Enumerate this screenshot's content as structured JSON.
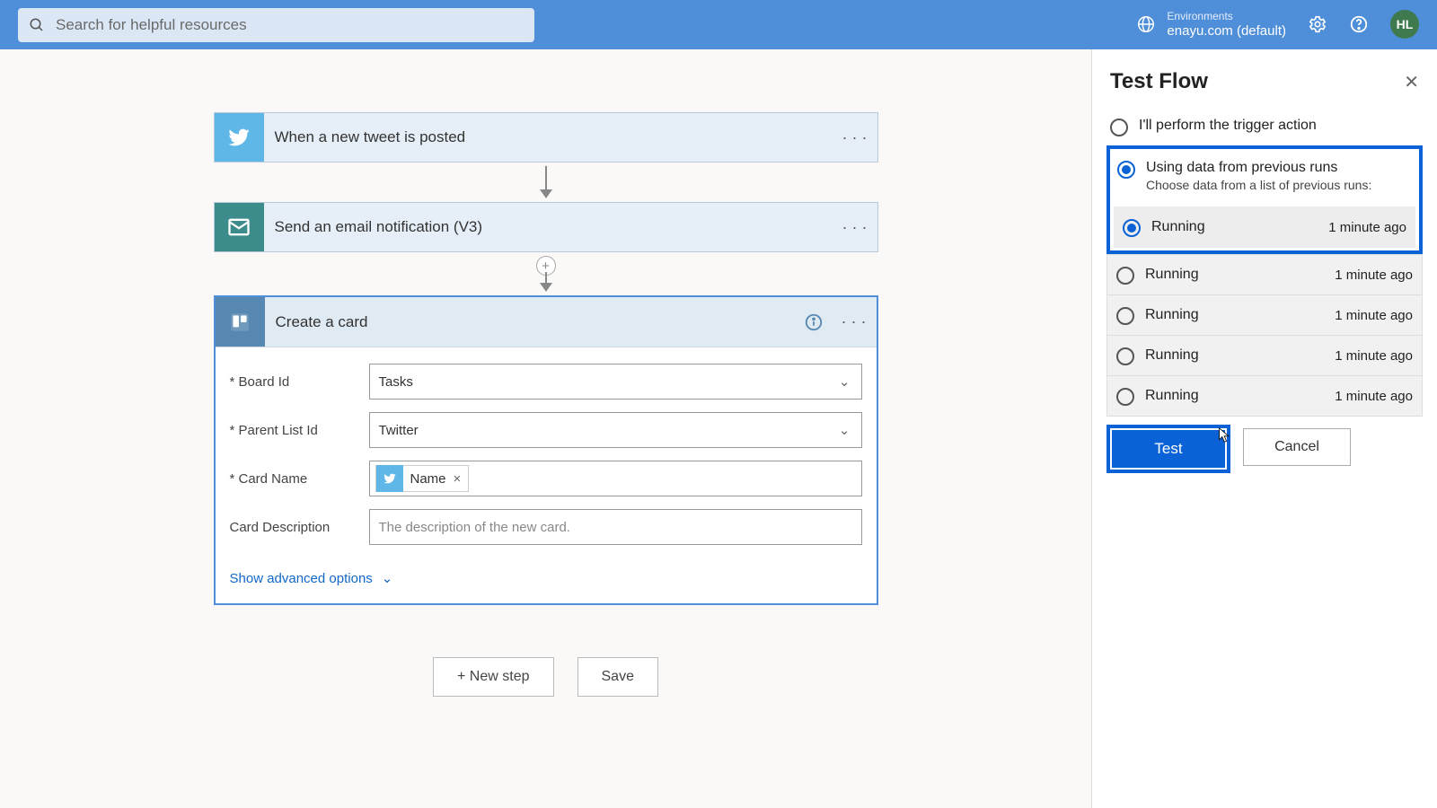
{
  "header": {
    "search_placeholder": "Search for helpful resources",
    "env_label": "Environments",
    "env_name": "enayu.com (default)",
    "avatar": "HL"
  },
  "flow": {
    "step1_title": "When a new tweet is posted",
    "step2_title": "Send an email notification (V3)",
    "step3_title": "Create a card",
    "form": {
      "board_label": "* Board Id",
      "board_value": "Tasks",
      "parent_label": "* Parent List Id",
      "parent_value": "Twitter",
      "cardname_label": "* Card Name",
      "cardname_token": "Name",
      "desc_label": "Card Description",
      "desc_placeholder": "The description of the new card."
    },
    "advanced": "Show advanced options",
    "new_step": "+ New step",
    "save": "Save"
  },
  "panel": {
    "title": "Test Flow",
    "opt1": "I'll perform the trigger action",
    "opt2": "Using data from previous runs",
    "opt2_sub": "Choose data from a list of previous runs:",
    "runs": [
      {
        "status": "Running",
        "time": "1 minute ago",
        "selected": true
      },
      {
        "status": "Running",
        "time": "1 minute ago",
        "selected": false
      },
      {
        "status": "Running",
        "time": "1 minute ago",
        "selected": false
      },
      {
        "status": "Running",
        "time": "1 minute ago",
        "selected": false
      },
      {
        "status": "Running",
        "time": "1 minute ago",
        "selected": false
      }
    ],
    "test": "Test",
    "cancel": "Cancel"
  }
}
